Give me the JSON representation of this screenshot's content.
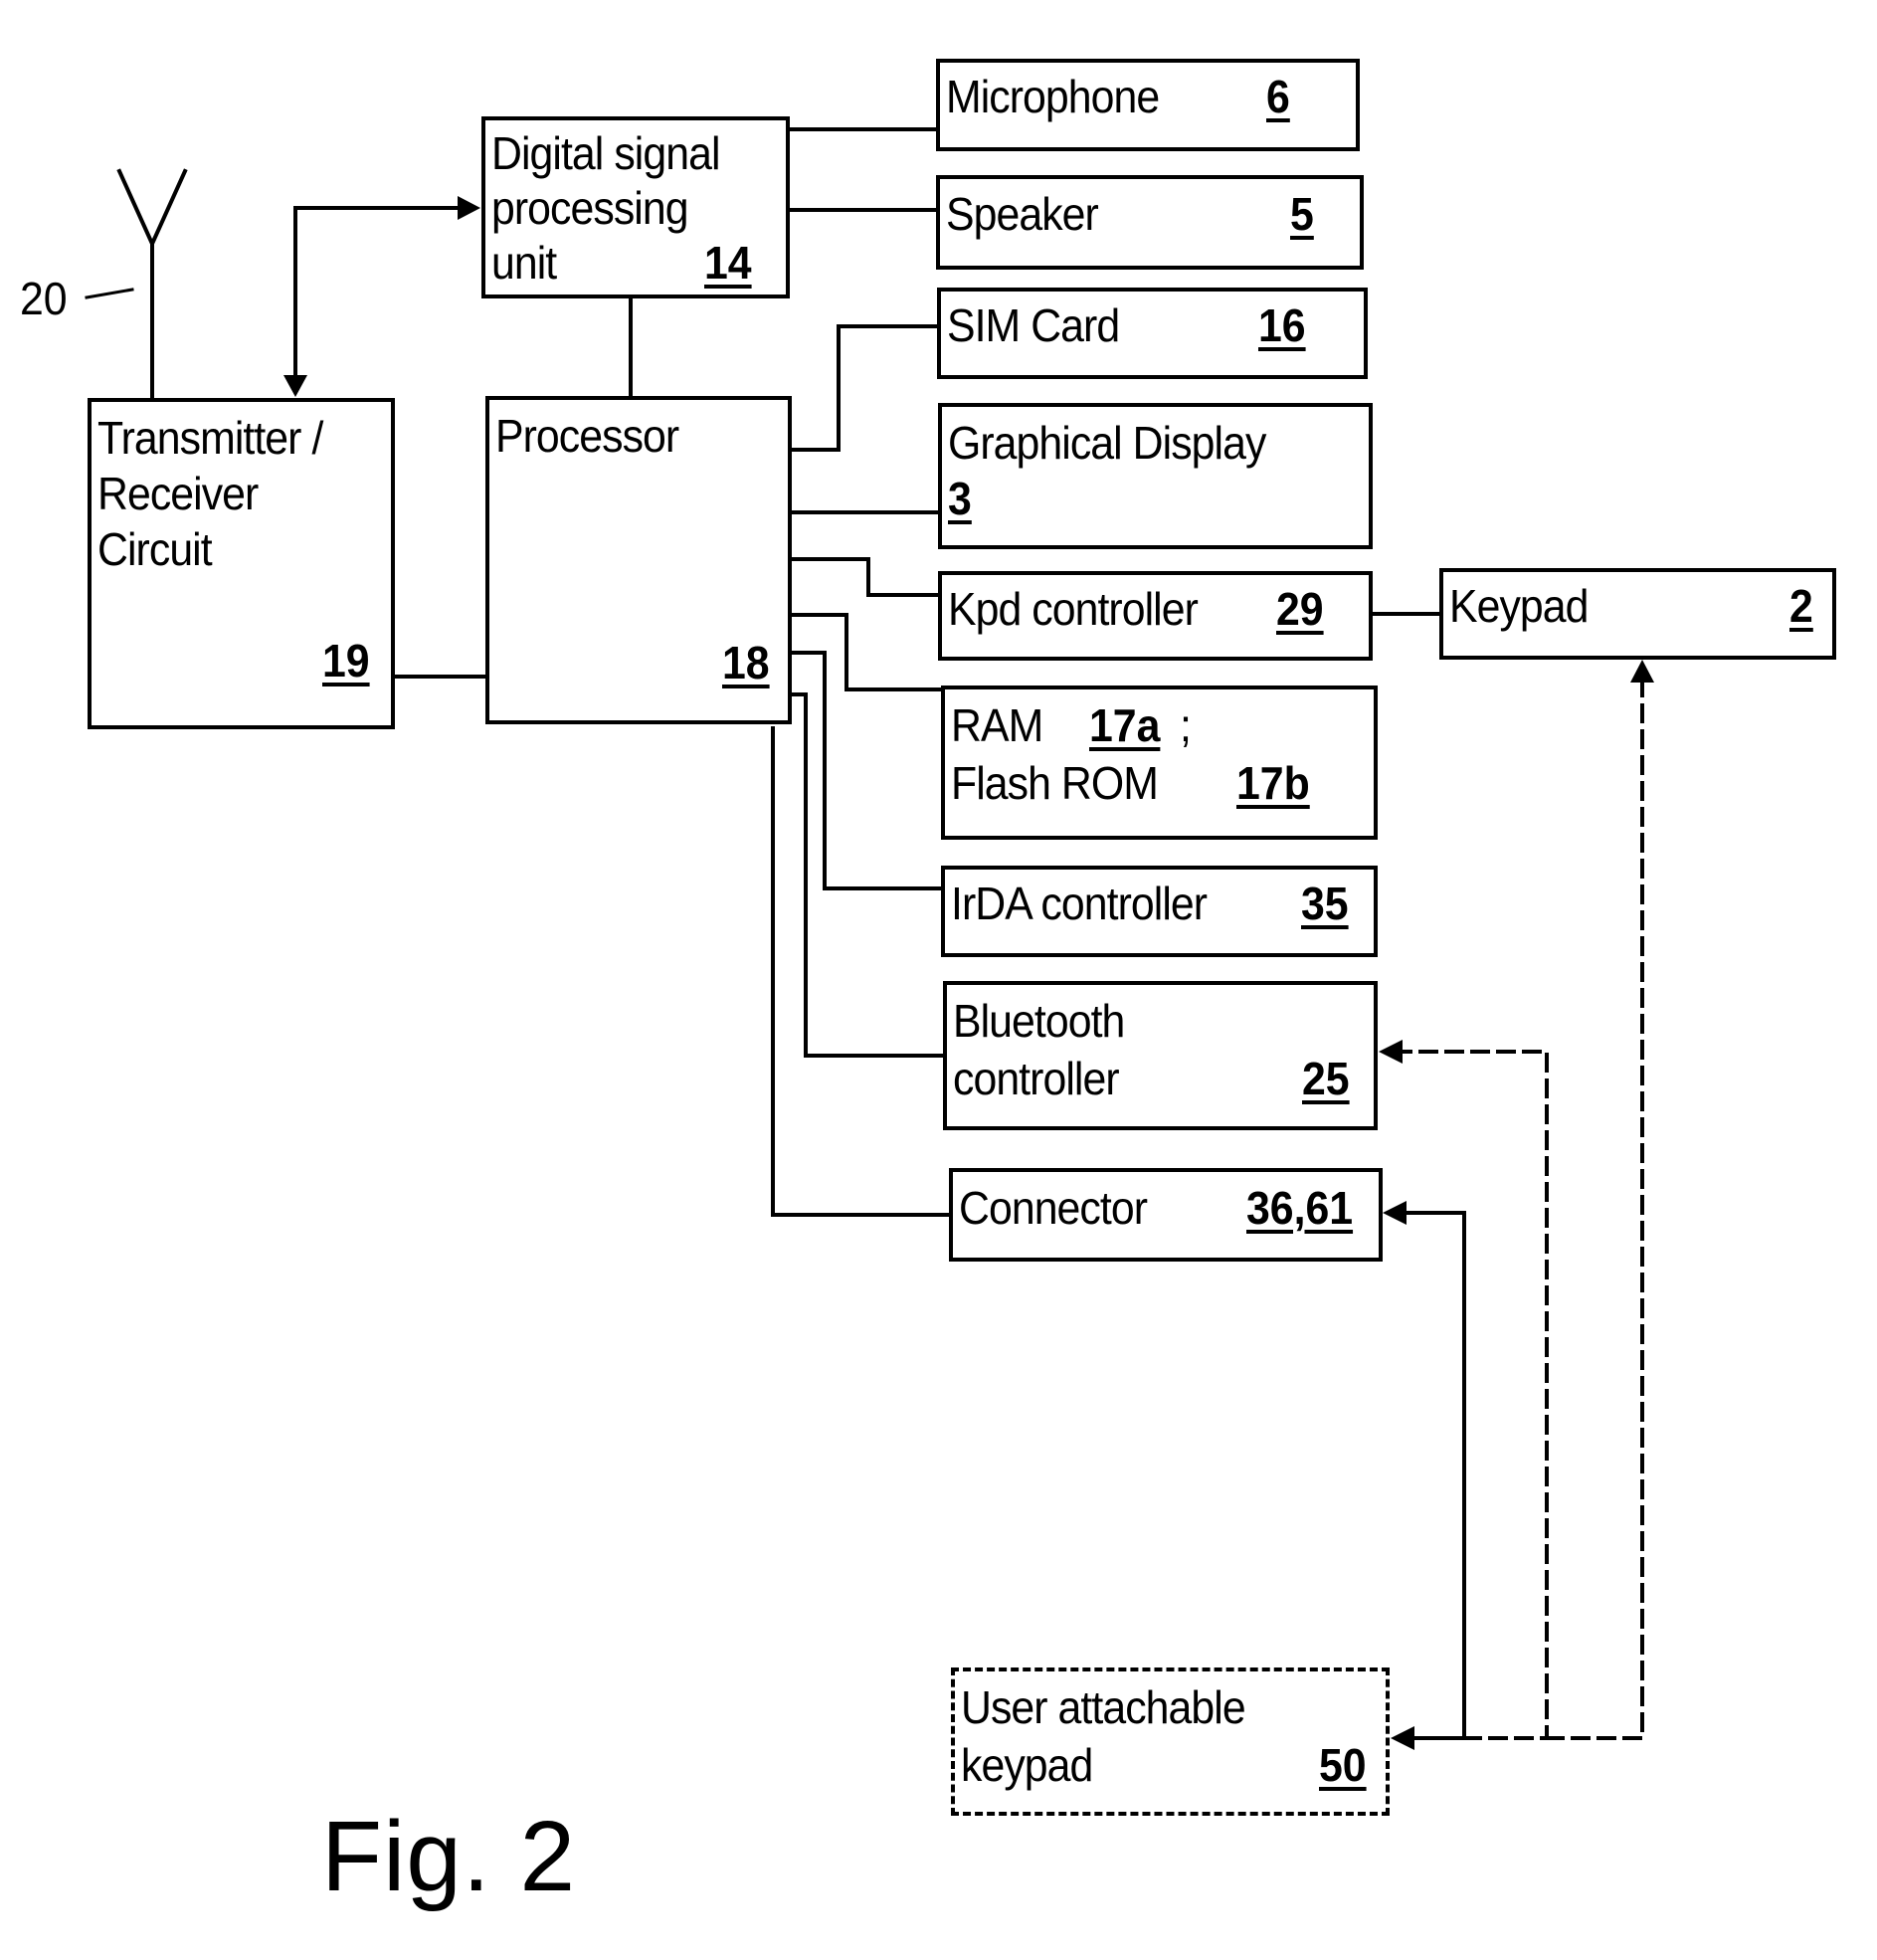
{
  "figure": {
    "caption": "Fig. 2",
    "antenna_ref": "20"
  },
  "blocks": {
    "dsp": {
      "lines": [
        "Digital signal",
        "processing",
        "unit"
      ],
      "ref": "14"
    },
    "transceiver": {
      "lines": [
        "Transmitter /",
        "Receiver",
        "Circuit"
      ],
      "ref": "19"
    },
    "processor": {
      "lines": [
        "Processor"
      ],
      "ref": "18"
    },
    "microphone": {
      "label": "Microphone",
      "ref": "6"
    },
    "speaker": {
      "label": "Speaker",
      "ref": "5"
    },
    "sim_card": {
      "label": "SIM Card",
      "ref": "16"
    },
    "graphical_display": {
      "label": "Graphical Display",
      "ref": "3"
    },
    "kpd_controller": {
      "label": "Kpd controller",
      "ref": "29"
    },
    "keypad": {
      "label": "Keypad",
      "ref": "2"
    },
    "memory": {
      "line1": "RAM",
      "ref_a": "17a",
      "sep": ";",
      "line2": "Flash ROM",
      "ref_b": "17b"
    },
    "irda": {
      "label": "IrDA controller",
      "ref": "35"
    },
    "bluetooth": {
      "lines": [
        "Bluetooth",
        "controller"
      ],
      "ref": "25"
    },
    "connector": {
      "label": "Connector",
      "ref": "36,61"
    },
    "user_keypad": {
      "lines": [
        "User attachable",
        "keypad"
      ],
      "ref": "50"
    }
  }
}
